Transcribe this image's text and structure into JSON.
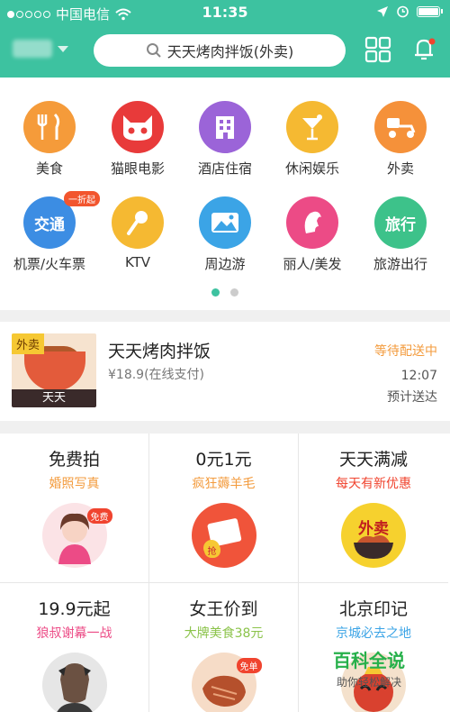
{
  "status_bar": {
    "carrier": "中国电信",
    "time": "11:35"
  },
  "header": {
    "search_placeholder": "天天烤肉拌饭(外卖)"
  },
  "categories": [
    {
      "label": "美食",
      "color": "#f59b3a",
      "icon": "cutlery-icon"
    },
    {
      "label": "猫眼电影",
      "color": "#e83a3a",
      "icon": "cat-face-icon"
    },
    {
      "label": "酒店住宿",
      "color": "#9b64d8",
      "icon": "hotel-building-icon"
    },
    {
      "label": "休闲娱乐",
      "color": "#f5b932",
      "icon": "cocktail-icon"
    },
    {
      "label": "外卖",
      "color": "#f5913a",
      "icon": "scooter-icon"
    },
    {
      "label": "机票/火车票",
      "color": "#3c8de3",
      "icon_text": "交通",
      "promo": "一折起"
    },
    {
      "label": "KTV",
      "color": "#f5b932",
      "icon": "microphone-icon"
    },
    {
      "label": "周边游",
      "color": "#3ba4e6",
      "icon": "landscape-icon"
    },
    {
      "label": "丽人/美发",
      "color": "#ec4b86",
      "icon": "woman-profile-icon"
    },
    {
      "label": "旅游出行",
      "color": "#3dc28a",
      "icon_text": "旅行"
    }
  ],
  "order": {
    "tag": "外卖",
    "brand": "天天",
    "name": "天天烤肉拌饭",
    "price": "¥18.9(在线支付)",
    "state": "等待配送中",
    "eta": "12:07",
    "eta_label": "预计送达"
  },
  "promos": [
    {
      "title": "免费拍",
      "subtitle": "婚照写真",
      "sub_color": "#f39b3d",
      "chip": "免费"
    },
    {
      "title": "0元1元",
      "subtitle": "疯狂薅羊毛",
      "sub_color": "#f39b3d",
      "chip": "抢"
    },
    {
      "title": "天天满减",
      "subtitle": "每天有新优惠",
      "sub_color": "#f0442f",
      "badge_text": "外卖"
    },
    {
      "title": "19.9元起",
      "subtitle": "狼叔谢幕一战",
      "sub_color": "#ec4b86"
    },
    {
      "title": "女王价到",
      "subtitle": "大牌美食38元",
      "sub_color": "#8bc34a",
      "chip": "免单"
    },
    {
      "title": "北京印记",
      "subtitle": "京城必去之地",
      "sub_color": "#3ba4e6"
    }
  ],
  "watermark": {
    "title": "百科全说",
    "subtitle": "助你轻松解决"
  }
}
